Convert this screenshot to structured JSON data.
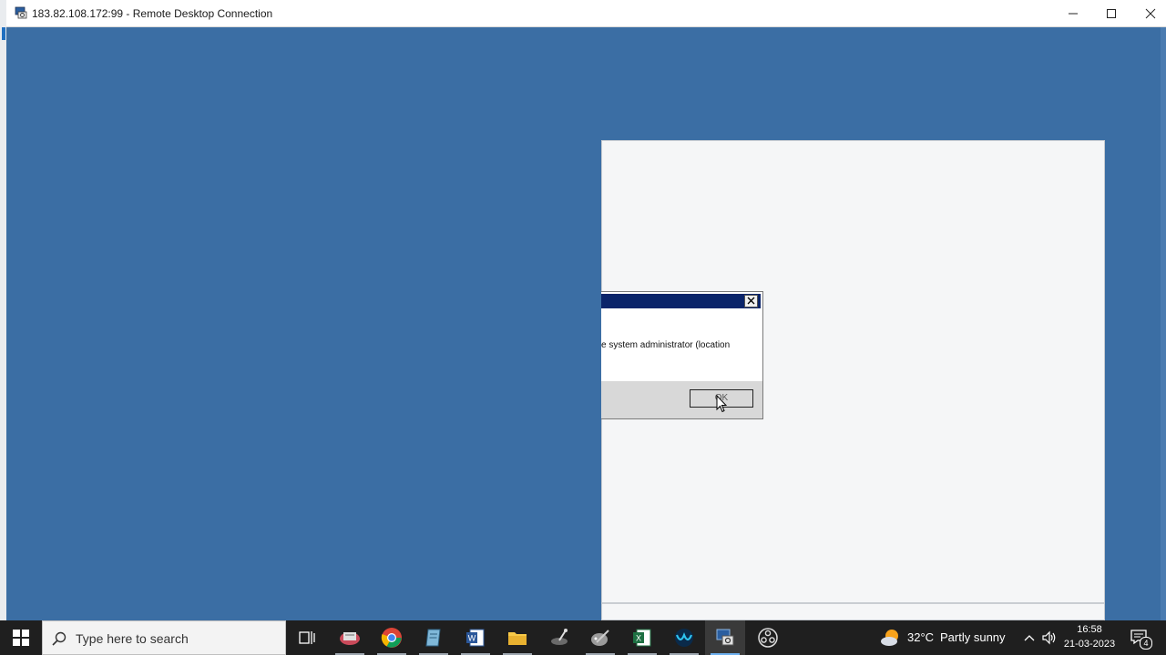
{
  "window": {
    "title": "183.82.108.172:99 - Remote Desktop Connection",
    "icon": "remote-desktop-icon"
  },
  "dialog": {
    "message_fragment": "e system administrator (location",
    "ok_label": "OK"
  },
  "taskbar": {
    "search_placeholder": "Type here to search",
    "icons": [
      "task-view-icon",
      "app-icon",
      "chrome-icon",
      "notepad-icon",
      "word-icon",
      "file-explorer-icon",
      "paint-icon",
      "inkscape-icon",
      "excel-icon",
      "webex-icon",
      "remote-desktop-icon",
      "obs-icon"
    ]
  },
  "tray": {
    "temperature": "32°C",
    "condition": "Partly sunny",
    "time": "16:58",
    "date": "21-03-2023",
    "notification_count": "4"
  },
  "colors": {
    "desktop": "#3b6ea4",
    "dialog_title": "#0a246a",
    "taskbar": "#1f1f1f"
  }
}
